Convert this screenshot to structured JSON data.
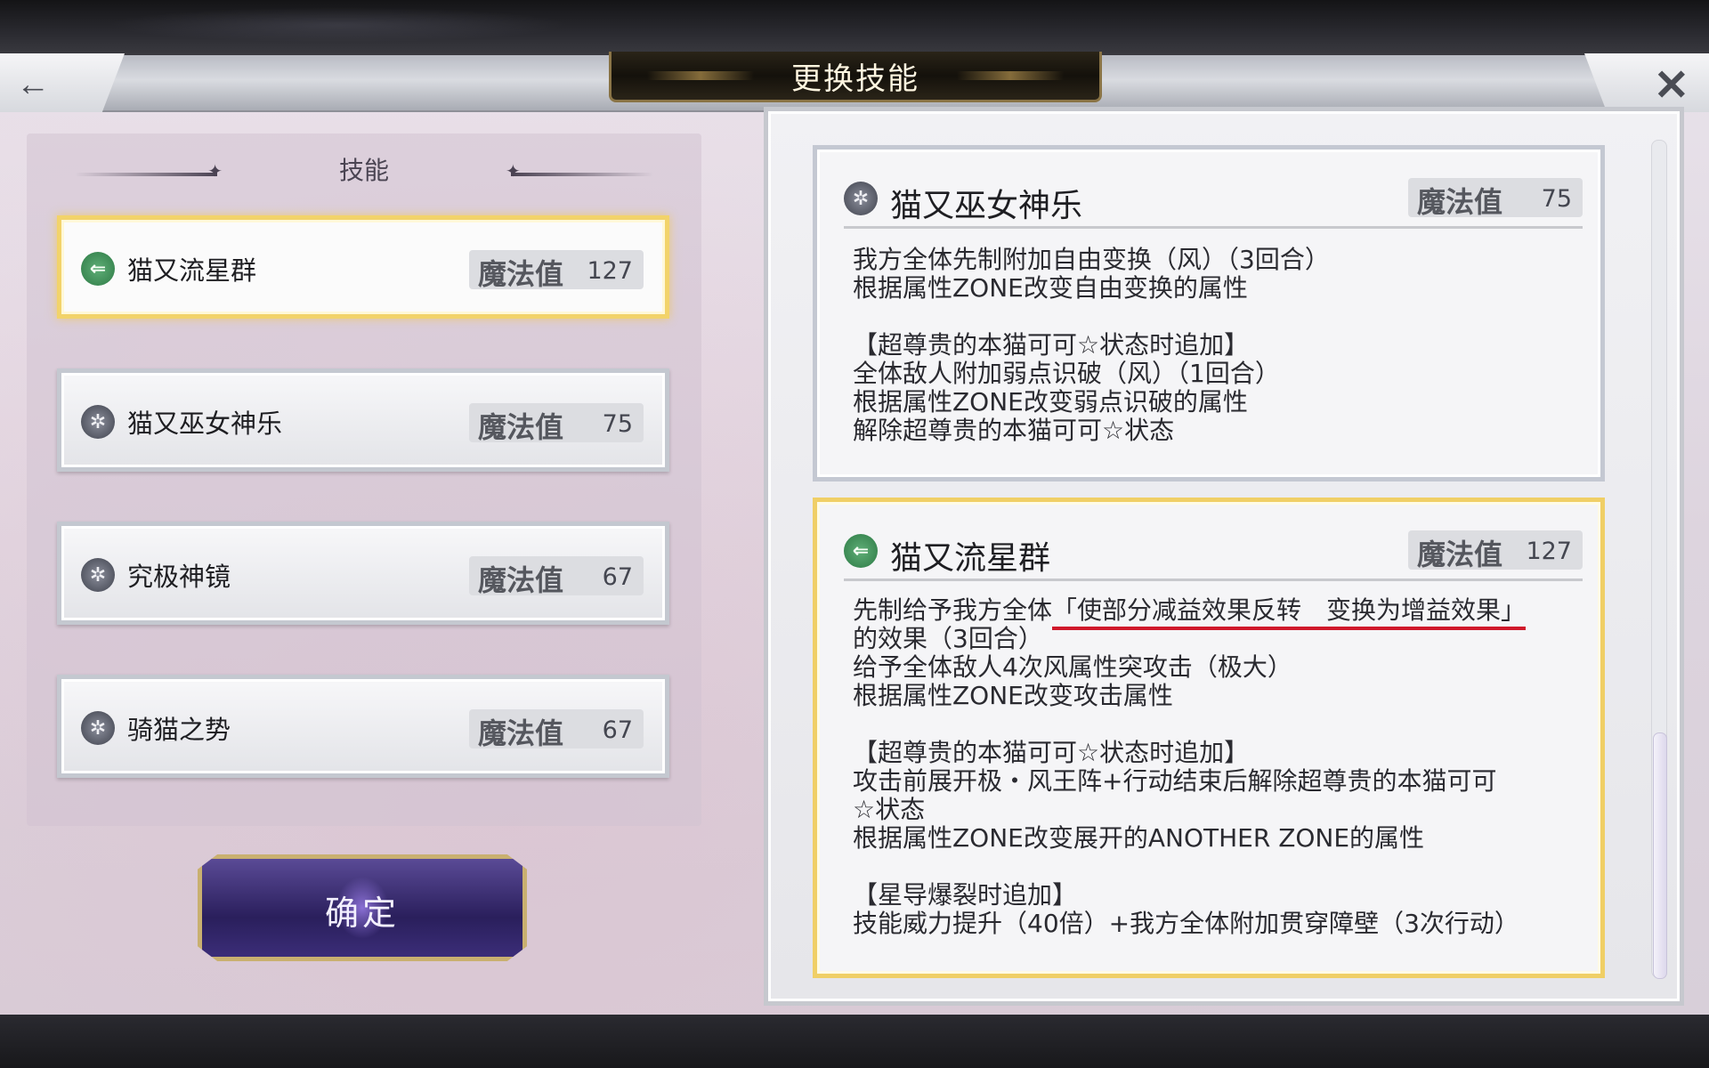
{
  "header": {
    "title": "更换技能",
    "back_icon": "←",
    "close_icon": "✕"
  },
  "skill_list": {
    "heading": "技能",
    "items": [
      {
        "name": "猫又流星群",
        "mp_label": "魔法值",
        "mp": "127",
        "icon": "wind-element-icon",
        "selected": true
      },
      {
        "name": "猫又巫女神乐",
        "mp_label": "魔法值",
        "mp": "75",
        "icon": "star-element-icon",
        "selected": false
      },
      {
        "name": "究极神镜",
        "mp_label": "魔法值",
        "mp": "67",
        "icon": "star-element-icon",
        "selected": false
      },
      {
        "name": "骑猫之势",
        "mp_label": "魔法值",
        "mp": "67",
        "icon": "star-element-icon",
        "selected": false
      }
    ]
  },
  "confirm_label": "确定",
  "details": [
    {
      "name": "猫又巫女神乐",
      "mp_label": "魔法值",
      "mp": "75",
      "lines": [
        "我方全体先制附加自由变换（风）（3回合）",
        "根据属性ZONE改变自由变换的属性",
        "",
        "【超尊贵的本猫可可☆状态时追加】",
        "全体敌人附加弱点识破（风）（1回合）",
        "根据属性ZONE改变弱点识破的属性",
        "解除超尊贵的本猫可可☆状态"
      ]
    },
    {
      "name": "猫又流星群",
      "mp_label": "魔法值",
      "mp": "127",
      "line1_prefix": "先制给予我方全体",
      "line1_highlight": "「使部分减益效果反转　变换为增益效果」",
      "lines": [
        "的效果（3回合）",
        "给予全体敌人4次风属性突攻击（极大）",
        "根据属性ZONE改变攻击属性",
        "",
        "【超尊贵的本猫可可☆状态时追加】",
        "攻击前展开极・风王阵+行动结束后解除超尊贵的本猫可可",
        "☆状态",
        "根据属性ZONE改变展开的ANOTHER ZONE的属性",
        "",
        "【星导爆裂时追加】",
        "技能威力提升（40倍）+我方全体附加贯穿障壁（3次行动）"
      ]
    }
  ],
  "colors": {
    "selected_border": "#f2d36a",
    "highlight_underline": "#d0182a",
    "confirm_button": "#2a1f5c"
  }
}
